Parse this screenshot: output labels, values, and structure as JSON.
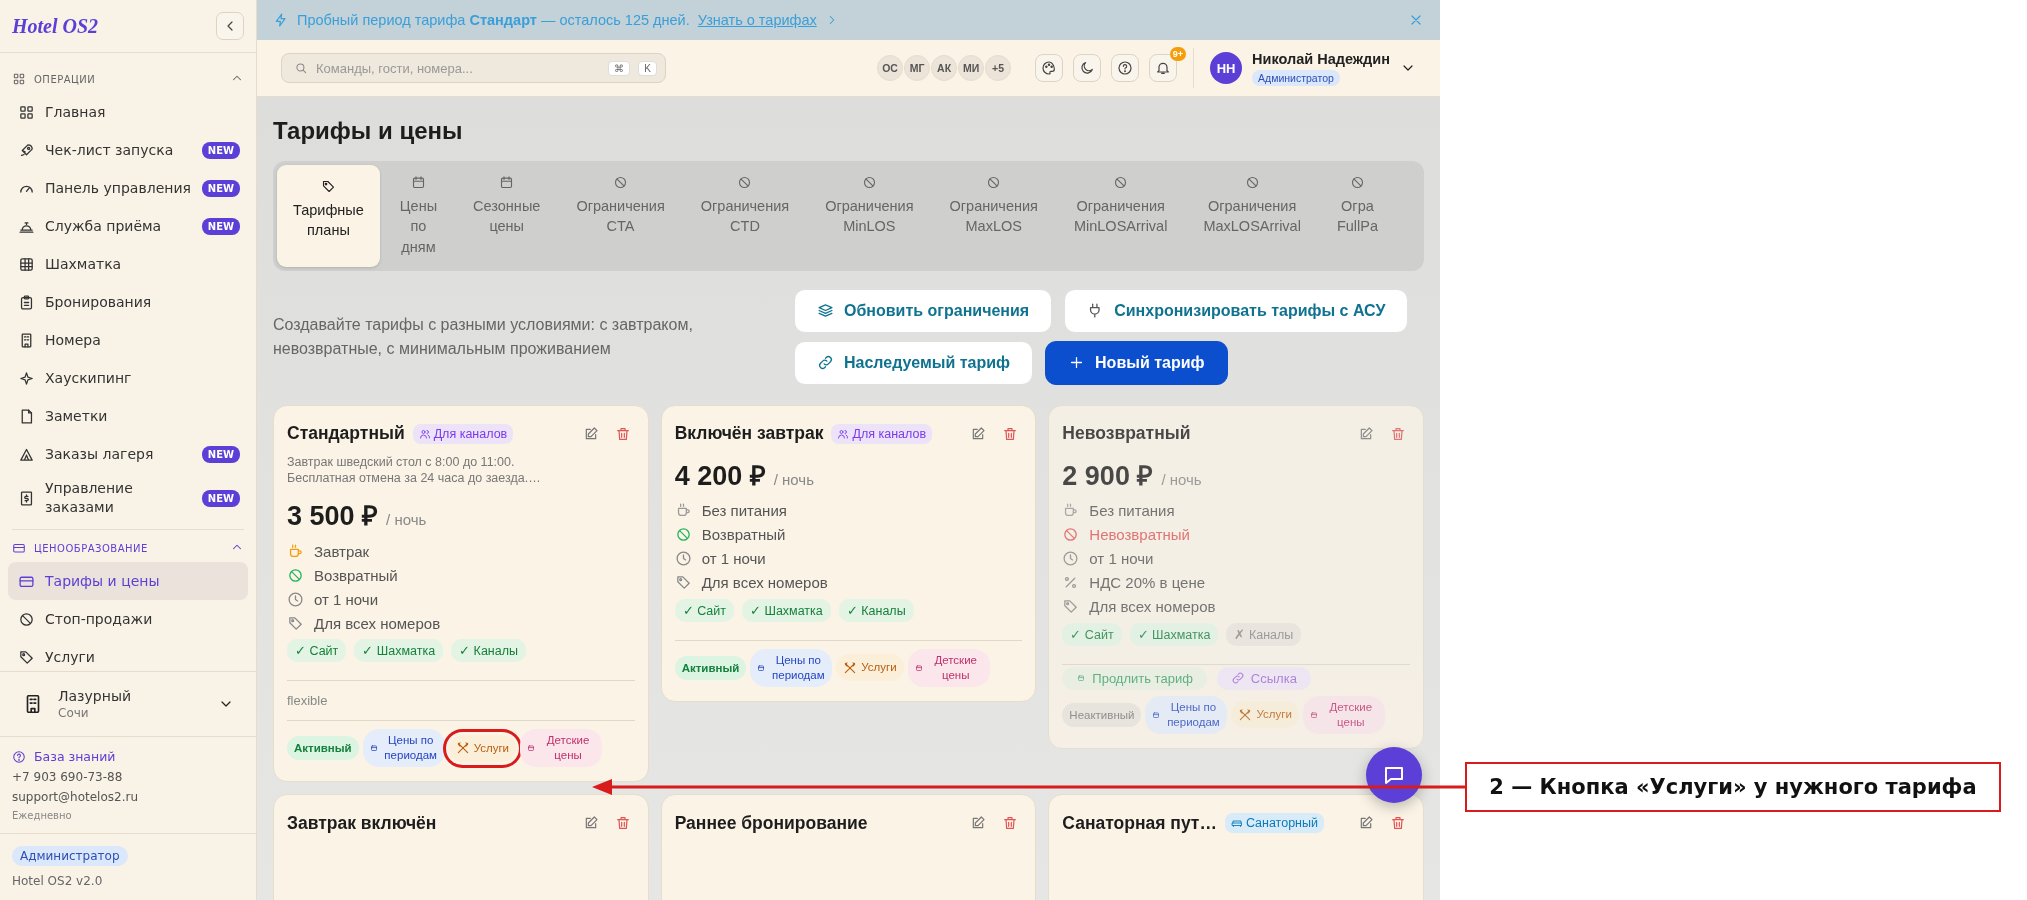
{
  "sidebar": {
    "logo": "Hotel OS2",
    "sections": [
      {
        "title": "ОПЕРАЦИИ",
        "expanded": true,
        "selected": false,
        "items": [
          {
            "label": "Главная",
            "selected": false
          },
          {
            "label": "Чек-лист запуска",
            "badge": "NEW",
            "selected": false
          },
          {
            "label": "Панель управления",
            "badge": "NEW",
            "selected": false
          },
          {
            "label": "Служба приёма",
            "badge": "NEW",
            "selected": false
          },
          {
            "label": "Шахматка",
            "selected": false
          },
          {
            "label": "Бронирования",
            "selected": false
          },
          {
            "label": "Номера",
            "selected": false
          },
          {
            "label": "Хаускипинг",
            "selected": false
          },
          {
            "label": "Заметки",
            "selected": false
          },
          {
            "label": "Заказы лагеря",
            "badge": "NEW",
            "selected": false
          },
          {
            "label": "Управление заказами",
            "badge": "NEW",
            "selected": false
          }
        ]
      },
      {
        "title": "ЦЕНООБРАЗОВАНИЕ",
        "expanded": true,
        "selected": true,
        "items": [
          {
            "label": "Тарифы и цены",
            "selected": true
          },
          {
            "label": "Стоп-продажи",
            "selected": false
          },
          {
            "label": "Услуги",
            "selected": false
          }
        ]
      }
    ],
    "hotel": {
      "name": "Лазурный",
      "city": "Сочи"
    },
    "help": {
      "link": "База знаний",
      "phone": "+7 903 690-73-88",
      "email": "support@hotelos2.ru",
      "hours": "Ежедневно"
    },
    "role": "Администратор",
    "version": "Hotel OS2 v2.0"
  },
  "banner": {
    "text": "Пробный период тарифа **Стандарт** — осталось 125 дней.",
    "link": "Узнать о тарифах"
  },
  "topbar": {
    "search": {
      "placeholder": "Команды, гости, номера...",
      "keys": [
        "⌘",
        "K"
      ]
    },
    "presence": [
      "ОС",
      "МГ",
      "АК",
      "МИ",
      "+5"
    ],
    "notifications": "9+",
    "user": {
      "initials": "НН",
      "name": "Николай Надеждин",
      "role": "Администратор"
    }
  },
  "page": {
    "title": "Тарифы и цены",
    "tabs": [
      {
        "label": "Тарифные планы",
        "selected": true
      },
      {
        "label": "Цены по дням",
        "selected": false
      },
      {
        "label": "Сезонные цены",
        "selected": false
      },
      {
        "label": "Ограничения CTA",
        "selected": false
      },
      {
        "label": "Ограничения CTD",
        "selected": false
      },
      {
        "label": "Ограничения MinLOS",
        "selected": false
      },
      {
        "label": "Ограничения MaxLOS",
        "selected": false
      },
      {
        "label": "Ограничения MinLOSArrival",
        "selected": false
      },
      {
        "label": "Ограничения MaxLOSArrival",
        "selected": false
      },
      {
        "label": "Огра FullPa",
        "selected": false
      }
    ],
    "description": "Создавайте тарифы с разными условиями: с завтраком, невозвратные, с минимальным проживанием",
    "actions": [
      {
        "label": "Обновить ограничения",
        "kind": "layers"
      },
      {
        "label": "Синхронизировать тарифы с АСУ",
        "kind": "plug"
      },
      {
        "label": "Наследуемый тариф",
        "kind": "link"
      },
      {
        "label": "Новый тариф",
        "kind": "primary"
      }
    ]
  },
  "cards": [
    {
      "title": "Стандартный",
      "badge": {
        "text": "Для каналов",
        "kind": "channels"
      },
      "active": true,
      "description": [
        "Завтрак шведский стол с 8:00 до 11:00.",
        "Бесплатная отмена за 24 часа до заезда.…"
      ],
      "price": "3 500 ₽",
      "unit": "/ ночь",
      "features": [
        {
          "kind": "meal",
          "on": true,
          "text": "Завтрак"
        },
        {
          "kind": "refund",
          "on": true,
          "text": "Возвратный"
        },
        {
          "kind": "nights",
          "text": "от 1 ночи"
        },
        {
          "kind": "rooms",
          "text": "Для всех номеров"
        }
      ],
      "channels": [
        {
          "label": "✓ Сайт",
          "on": true
        },
        {
          "label": "✓ Шахматка",
          "on": true
        },
        {
          "label": "✓ Каналы",
          "on": true
        }
      ],
      "note": "flexible",
      "status": "Активный",
      "actions": [
        {
          "kind": "periods",
          "label": "Цены по периодам",
          "highlighted": false
        },
        {
          "kind": "services",
          "label": "Услуги",
          "highlighted": true
        },
        {
          "kind": "kids",
          "label": "Детские цены",
          "highlighted": false
        }
      ]
    },
    {
      "title": "Включён завтрак",
      "badge": {
        "text": "Для каналов",
        "kind": "channels"
      },
      "active": true,
      "price": "4 200 ₽",
      "unit": "/ ночь",
      "features": [
        {
          "kind": "meal",
          "on": false,
          "text": "Без питания"
        },
        {
          "kind": "refund",
          "on": true,
          "text": "Возвратный"
        },
        {
          "kind": "nights",
          "text": "от 1 ночи"
        },
        {
          "kind": "rooms",
          "text": "Для всех номеров"
        }
      ],
      "channels": [
        {
          "label": "✓ Сайт",
          "on": true
        },
        {
          "label": "✓ Шахматка",
          "on": true
        },
        {
          "label": "✓ Каналы",
          "on": true
        }
      ],
      "status": "Активный",
      "actions": [
        {
          "kind": "periods",
          "label": "Цены по периодам",
          "highlighted": false
        },
        {
          "kind": "services",
          "label": "Услуги",
          "highlighted": false
        },
        {
          "kind": "kids",
          "label": "Детские цены",
          "highlighted": false
        }
      ]
    },
    {
      "title": "Невозвратный",
      "active": false,
      "price": "2 900 ₽",
      "unit": "/ ночь",
      "features": [
        {
          "kind": "meal",
          "on": false,
          "text": "Без питания"
        },
        {
          "kind": "refund",
          "on": false,
          "text": "Невозвратный"
        },
        {
          "kind": "nights",
          "text": "от 1 ночи"
        },
        {
          "kind": "vat",
          "text": "НДС 20% в цене"
        },
        {
          "kind": "rooms",
          "text": "Для всех номеров"
        }
      ],
      "channels": [
        {
          "label": "✓ Сайт",
          "on": true
        },
        {
          "label": "✓ Шахматка",
          "on": true
        },
        {
          "label": "✗ Каналы",
          "on": false
        }
      ],
      "links": [
        {
          "kind": "extend",
          "label": "Продлить тариф"
        },
        {
          "kind": "link",
          "label": "Ссылка"
        }
      ],
      "status": "Неактивный",
      "actions": [
        {
          "kind": "periods",
          "label": "Цены по периодам",
          "highlighted": false
        },
        {
          "kind": "services",
          "label": "Услуги",
          "highlighted": false
        },
        {
          "kind": "kids",
          "label": "Детские цены",
          "highlighted": false
        }
      ]
    },
    {
      "title": "Завтрак включён",
      "active": true
    },
    {
      "title": "Раннее бронирование",
      "active": true
    },
    {
      "title": "Санаторная пут…",
      "badge": {
        "text": "Санаторный",
        "kind": "sanatorium"
      },
      "active": true
    }
  ],
  "annotation": {
    "text": "2 — Кнопка «Услуги» у нужного тарифа"
  }
}
